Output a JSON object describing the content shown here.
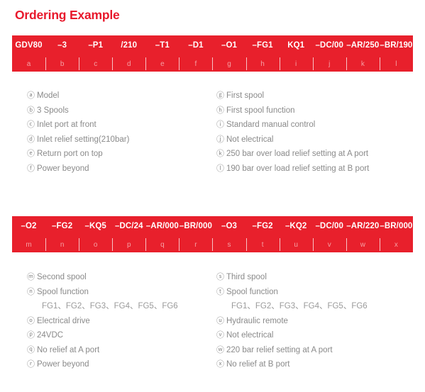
{
  "page": {
    "title": "Ordering Example",
    "accent_color": "#e8202c",
    "text_color": "#8a8a8a",
    "bar_letter_color": "#f5a0a4"
  },
  "sections": [
    {
      "bar": {
        "codes": [
          "GDV80",
          "–3",
          "–P1",
          "/210",
          "–T1",
          "–D1",
          "–O1",
          "–FG1",
          "KQ1",
          "–DC/00",
          "–AR/250",
          "–BR/190"
        ],
        "letters": [
          "a",
          "b",
          "c",
          "d",
          "e",
          "f",
          "g",
          "h",
          "i",
          "j",
          "k",
          "l"
        ]
      },
      "legend_left": [
        {
          "marker": "ⓐ",
          "text": "Model"
        },
        {
          "marker": "ⓑ",
          "text": "3 Spools"
        },
        {
          "marker": "ⓒ",
          "text": "Inlet port at front"
        },
        {
          "marker": "ⓓ",
          "text": "Inlet relief setting(210bar)"
        },
        {
          "marker": "ⓔ",
          "text": "Return port on top"
        },
        {
          "marker": "ⓕ",
          "text": "Power beyond"
        }
      ],
      "legend_right": [
        {
          "marker": "ⓖ",
          "text": "First spool"
        },
        {
          "marker": "ⓗ",
          "text": "First spool function"
        },
        {
          "marker": "ⓘ",
          "text": "Standard manual control"
        },
        {
          "marker": "ⓙ",
          "text": "Not electrical"
        },
        {
          "marker": "ⓚ",
          "text": "250 bar over load relief setting at A port"
        },
        {
          "marker": "ⓛ",
          "text": "190 bar over load relief setting at B port"
        }
      ]
    },
    {
      "bar": {
        "codes": [
          "–O2",
          "–FG2",
          "–KQ5",
          "–DC/24",
          "–AR/000",
          "–BR/000",
          "–O3",
          "–FG2",
          "–KQ2",
          "–DC/00",
          "–AR/220",
          "–BR/000"
        ],
        "letters": [
          "m",
          "n",
          "o",
          "p",
          "q",
          "r",
          "s",
          "t",
          "u",
          "v",
          "w",
          "x"
        ]
      },
      "legend_left": [
        {
          "marker": "ⓜ",
          "text": "Second spool"
        },
        {
          "marker": "ⓝ",
          "text": "Spool function",
          "sub": "FG1、FG2、FG3、FG4、FG5、FG6"
        },
        {
          "marker": "ⓞ",
          "text": "Electrical drive"
        },
        {
          "marker": "ⓟ",
          "text": "24VDC"
        },
        {
          "marker": "ⓠ",
          "text": "No relief at A port"
        },
        {
          "marker": "ⓡ",
          "text": "Power beyond"
        }
      ],
      "legend_right": [
        {
          "marker": "ⓢ",
          "text": "Third spool"
        },
        {
          "marker": "ⓣ",
          "text": "Spool function",
          "sub": "FG1、FG2、FG3、FG4、FG5、FG6"
        },
        {
          "marker": "ⓤ",
          "text": "Hydraulic remote"
        },
        {
          "marker": "ⓥ",
          "text": "Not electrical"
        },
        {
          "marker": "ⓦ",
          "text": "220 bar relief setting at A port"
        },
        {
          "marker": "ⓧ",
          "text": "No relief at B port"
        }
      ]
    }
  ]
}
